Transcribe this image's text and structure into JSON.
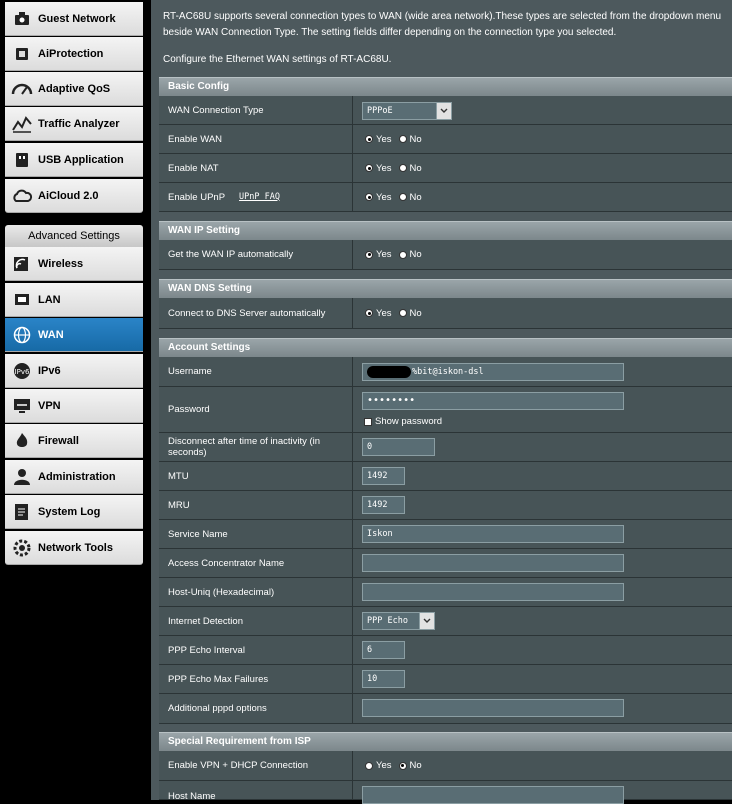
{
  "sidebar": {
    "items": [
      {
        "label": "Guest Network",
        "icon": "guest-network-icon"
      },
      {
        "label": "AiProtection",
        "icon": "aiprotection-icon"
      },
      {
        "label": "Adaptive QoS",
        "icon": "qos-gauge-icon"
      },
      {
        "label": "Traffic Analyzer",
        "icon": "traffic-analyzer-icon"
      },
      {
        "label": "USB Application",
        "icon": "usb-icon"
      },
      {
        "label": "AiCloud 2.0",
        "icon": "cloud-icon"
      }
    ],
    "advanced_header": "Advanced Settings",
    "advanced_items": [
      {
        "label": "Wireless",
        "icon": "wireless-icon"
      },
      {
        "label": "LAN",
        "icon": "lan-icon"
      },
      {
        "label": "WAN",
        "icon": "wan-globe-icon",
        "active": true
      },
      {
        "label": "IPv6",
        "icon": "ipv6-icon"
      },
      {
        "label": "VPN",
        "icon": "vpn-icon"
      },
      {
        "label": "Firewall",
        "icon": "firewall-icon"
      },
      {
        "label": "Administration",
        "icon": "administration-icon"
      },
      {
        "label": "System Log",
        "icon": "system-log-icon"
      },
      {
        "label": "Network Tools",
        "icon": "network-tools-icon"
      }
    ]
  },
  "intro": {
    "line1": "RT-AC68U supports several connection types to WAN (wide area network).These types are selected from the dropdown menu beside WAN Connection Type. The setting fields differ depending on the connection type you selected.",
    "line2": "Configure the Ethernet WAN settings of RT-AC68U."
  },
  "basic_config": {
    "title": "Basic Config",
    "wan_connection_type": {
      "label": "WAN Connection Type",
      "value": "PPPoE"
    },
    "enable_wan": {
      "label": "Enable WAN"
    },
    "enable_nat": {
      "label": "Enable NAT"
    },
    "enable_upnp": {
      "label": "Enable UPnP",
      "faq": "UPnP FAQ"
    }
  },
  "radio": {
    "yes": "Yes",
    "no": "No"
  },
  "wan_ip": {
    "title": "WAN IP Setting",
    "auto": {
      "label": "Get the WAN IP automatically"
    }
  },
  "wan_dns": {
    "title": "WAN DNS Setting",
    "auto": {
      "label": "Connect to DNS Server automatically"
    }
  },
  "account": {
    "title": "Account Settings",
    "username": {
      "label": "Username",
      "value": "%bit@iskon-dsl"
    },
    "password": {
      "label": "Password",
      "value": "••••••••",
      "show": "Show password"
    },
    "disconnect": {
      "label": "Disconnect after time of inactivity (in seconds)",
      "value": "0"
    },
    "mtu": {
      "label": "MTU",
      "value": "1492"
    },
    "mru": {
      "label": "MRU",
      "value": "1492"
    },
    "service_name": {
      "label": "Service Name",
      "value": "Iskon"
    },
    "access_concentrator": {
      "label": "Access Concentrator Name",
      "value": ""
    },
    "host_uniq": {
      "label": "Host-Uniq (Hexadecimal)",
      "value": ""
    },
    "internet_detection": {
      "label": "Internet Detection",
      "value": "PPP Echo"
    },
    "echo_interval": {
      "label": "PPP Echo Interval",
      "value": "6"
    },
    "echo_max": {
      "label": "PPP Echo Max Failures",
      "value": "10"
    },
    "pppd_options": {
      "label": "Additional pppd options",
      "value": ""
    }
  },
  "isp": {
    "title": "Special Requirement from ISP",
    "vpn_dhcp": {
      "label": "Enable VPN + DHCP Connection"
    },
    "host_name": {
      "label": "Host Name",
      "value": ""
    }
  }
}
